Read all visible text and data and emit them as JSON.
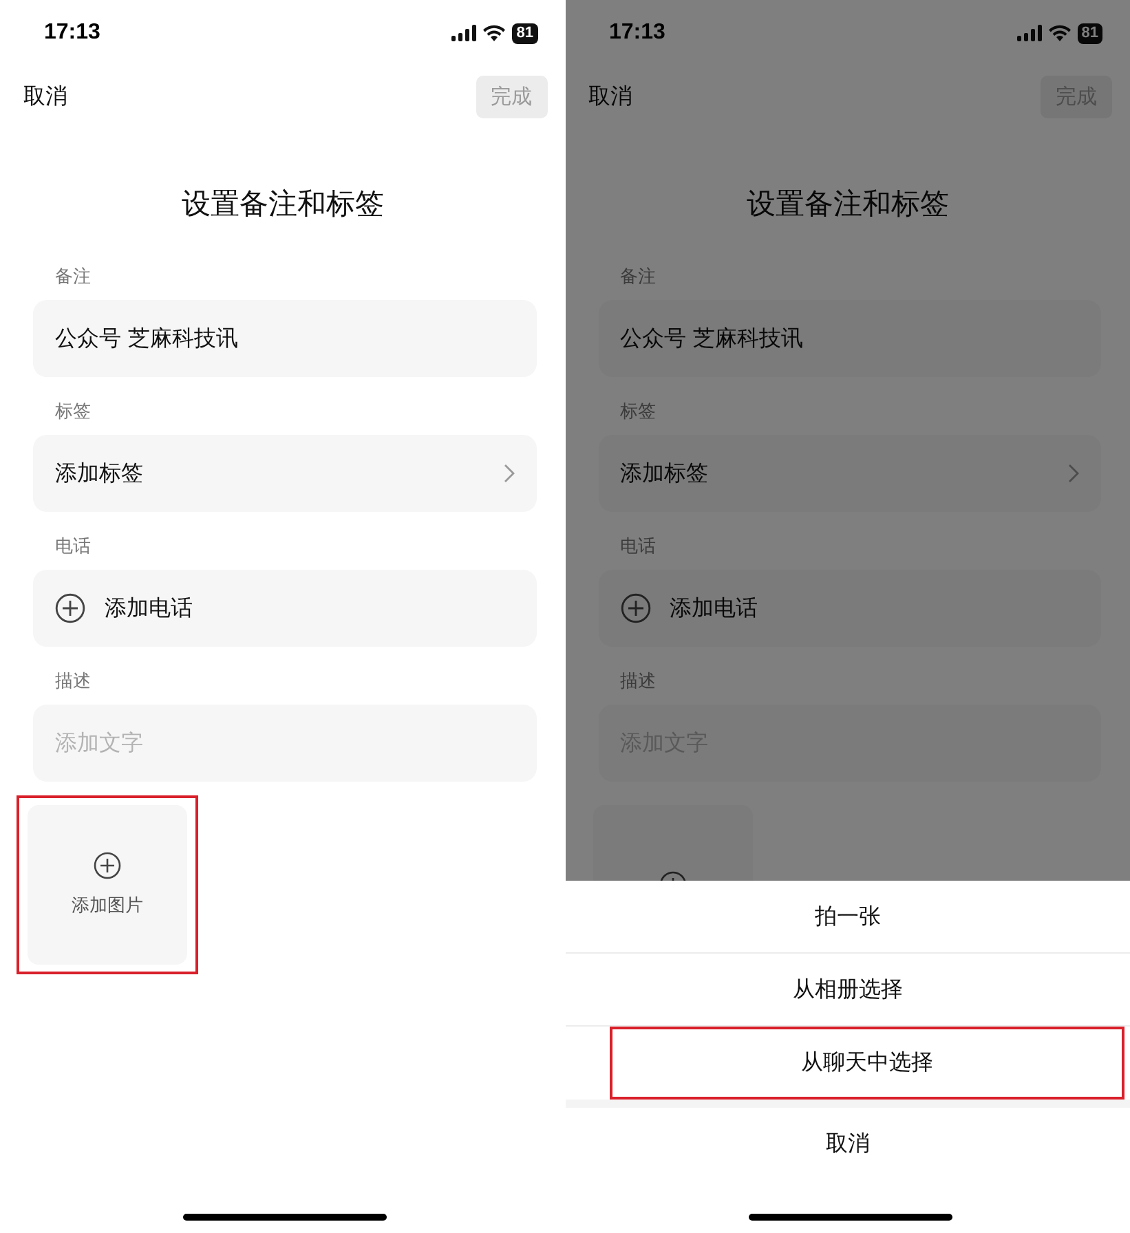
{
  "screens": [
    {
      "dimmed": false,
      "status": {
        "time": "17:13",
        "battery": "81"
      },
      "nav": {
        "cancel": "取消",
        "done": "完成",
        "done_disabled": true
      },
      "title": "设置备注和标签",
      "sections": [
        {
          "label": "备注",
          "kind": "text",
          "value": "公众号 芝麻科技讯"
        },
        {
          "label": "标签",
          "kind": "link",
          "value": "添加标签"
        },
        {
          "label": "电话",
          "kind": "add",
          "value": "添加电话"
        },
        {
          "label": "描述",
          "kind": "placeholder",
          "placeholder": "添加文字"
        }
      ],
      "photo_tile": {
        "label": "添加图片",
        "highlighted": true
      }
    },
    {
      "dimmed": true,
      "status": {
        "time": "17:13",
        "battery": "81"
      },
      "nav": {
        "cancel": "取消",
        "done": "完成",
        "done_disabled": true
      },
      "title": "设置备注和标签",
      "sections": [
        {
          "label": "备注",
          "kind": "text",
          "value": "公众号 芝麻科技讯"
        },
        {
          "label": "标签",
          "kind": "link",
          "value": "添加标签"
        },
        {
          "label": "电话",
          "kind": "add",
          "value": "添加电话"
        },
        {
          "label": "描述",
          "kind": "placeholder",
          "placeholder": "添加文字"
        }
      ],
      "photo_tile": {
        "highlighted": false
      },
      "sheet": {
        "items": [
          {
            "label": "拍一张",
            "highlighted": false
          },
          {
            "label": "从相册选择",
            "highlighted": false
          },
          {
            "label": "从聊天中选择",
            "highlighted": true
          }
        ],
        "cancel": "取消"
      }
    }
  ]
}
